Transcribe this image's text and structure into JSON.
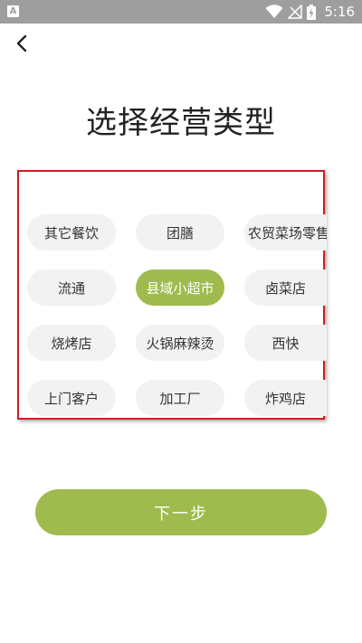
{
  "status_bar": {
    "time": "5:16",
    "icons": [
      "app-notification-icon",
      "wifi-icon",
      "no-signal-icon",
      "battery-charging-icon"
    ],
    "app_badge": "A"
  },
  "header": {
    "back_icon": "chevron-left-icon",
    "title": "选择经营类型"
  },
  "options": [
    {
      "label": "其它餐饮",
      "selected": false
    },
    {
      "label": "团膳",
      "selected": false
    },
    {
      "label": "农贸菜场零售",
      "selected": false
    },
    {
      "label": "流通",
      "selected": false
    },
    {
      "label": "县域小超市",
      "selected": true
    },
    {
      "label": "卤菜店",
      "selected": false
    },
    {
      "label": "烧烤店",
      "selected": false
    },
    {
      "label": "火锅麻辣烫",
      "selected": false
    },
    {
      "label": "西快",
      "selected": false
    },
    {
      "label": "上门客户",
      "selected": false
    },
    {
      "label": "加工厂",
      "selected": false
    },
    {
      "label": "炸鸡店",
      "selected": false
    }
  ],
  "footer": {
    "next_label": "下一步"
  },
  "colors": {
    "accent": "#9fbb4e",
    "chip_bg": "#f2f2f2",
    "highlight_border": "#cc1f1f",
    "status_bar": "#9e9e9e"
  }
}
